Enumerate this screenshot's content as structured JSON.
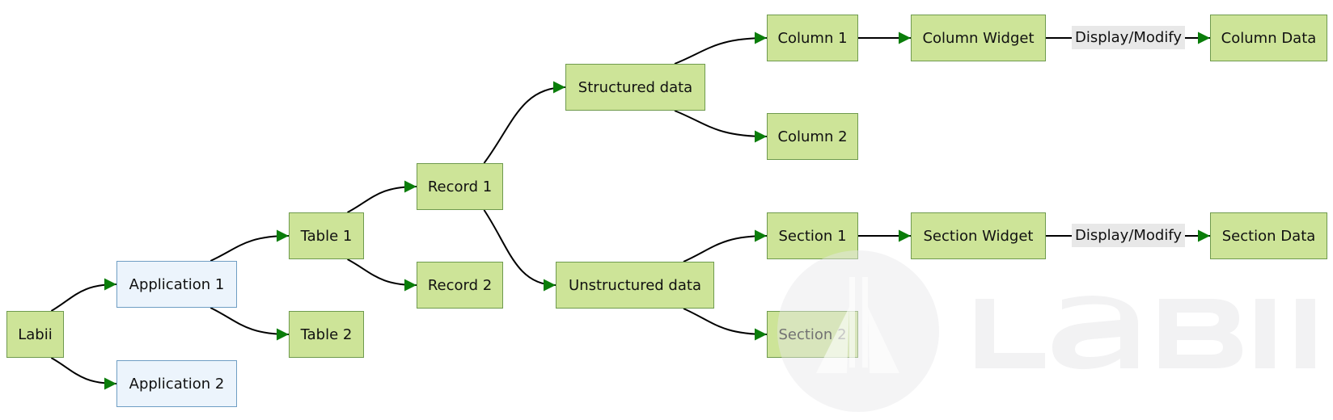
{
  "diagram": {
    "type": "flowchart",
    "direction": "left-to-right",
    "colors": {
      "node_fill": "#cde498",
      "node_border": "#6f9a4e",
      "app_fill": "#ecf4fc",
      "app_border": "#6f9ec4",
      "edge": "#000000",
      "arrowhead": "#0a7d0a",
      "edge_label_bg": "#e8e8e8",
      "watermark": "#f2f2f3"
    },
    "nodes": [
      {
        "id": "labii",
        "label": "Labii",
        "style": "green"
      },
      {
        "id": "app1",
        "label": "Application 1",
        "style": "blue"
      },
      {
        "id": "app2",
        "label": "Application 2",
        "style": "blue"
      },
      {
        "id": "table1",
        "label": "Table 1",
        "style": "green"
      },
      {
        "id": "table2",
        "label": "Table 2",
        "style": "green"
      },
      {
        "id": "record1",
        "label": "Record 1",
        "style": "green"
      },
      {
        "id": "record2",
        "label": "Record 2",
        "style": "green"
      },
      {
        "id": "structured",
        "label": "Structured data",
        "style": "green"
      },
      {
        "id": "unstructured",
        "label": "Unstructured data",
        "style": "green"
      },
      {
        "id": "column1",
        "label": "Column 1",
        "style": "green"
      },
      {
        "id": "column2",
        "label": "Column 2",
        "style": "green"
      },
      {
        "id": "section1",
        "label": "Section 1",
        "style": "green"
      },
      {
        "id": "section2",
        "label": "Section 2",
        "style": "green"
      },
      {
        "id": "colwidget",
        "label": "Column Widget",
        "style": "green"
      },
      {
        "id": "coldata",
        "label": "Column Data",
        "style": "green"
      },
      {
        "id": "secwidget",
        "label": "Section Widget",
        "style": "green"
      },
      {
        "id": "secdata",
        "label": "Section Data",
        "style": "green"
      }
    ],
    "edges": [
      {
        "from": "labii",
        "to": "app1"
      },
      {
        "from": "labii",
        "to": "app2"
      },
      {
        "from": "app1",
        "to": "table1"
      },
      {
        "from": "app1",
        "to": "table2"
      },
      {
        "from": "table1",
        "to": "record1"
      },
      {
        "from": "table1",
        "to": "record2"
      },
      {
        "from": "record1",
        "to": "structured"
      },
      {
        "from": "record1",
        "to": "unstructured"
      },
      {
        "from": "structured",
        "to": "column1"
      },
      {
        "from": "structured",
        "to": "column2"
      },
      {
        "from": "unstructured",
        "to": "section1"
      },
      {
        "from": "unstructured",
        "to": "section2"
      },
      {
        "from": "column1",
        "to": "colwidget"
      },
      {
        "from": "colwidget",
        "to": "coldata",
        "label": "Display/Modify"
      },
      {
        "from": "section1",
        "to": "secwidget"
      },
      {
        "from": "secwidget",
        "to": "secdata",
        "label": "Display/Modify"
      }
    ],
    "watermark": {
      "text": "LaBII",
      "icon": "flask-icon"
    }
  }
}
